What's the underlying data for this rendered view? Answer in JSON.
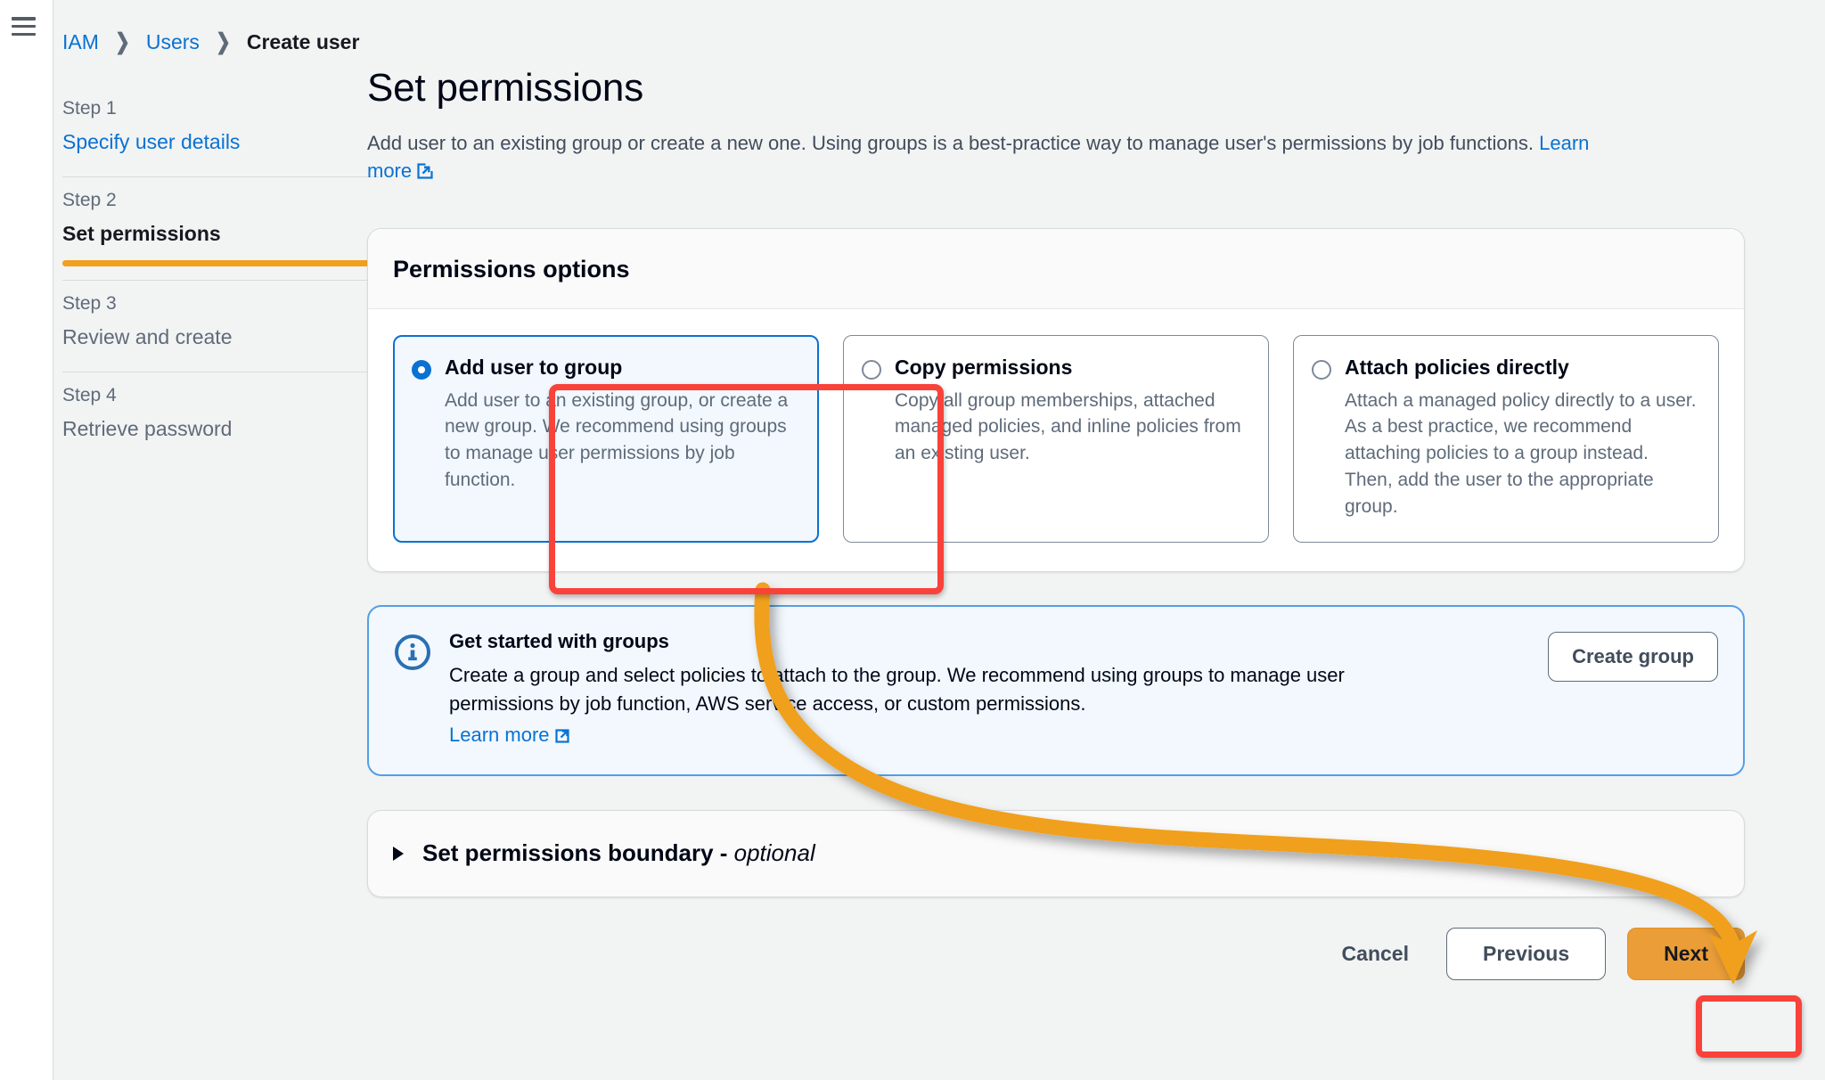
{
  "topbar": {
    "menu_icon": "hamburger-icon"
  },
  "breadcrumb": {
    "items": [
      {
        "label": "IAM",
        "type": "link"
      },
      {
        "label": "Users",
        "type": "link"
      },
      {
        "label": "Create user",
        "type": "current"
      }
    ],
    "separator": "❯"
  },
  "wizard": {
    "steps": [
      {
        "num": "Step 1",
        "label": "Specify user details",
        "state": "link"
      },
      {
        "num": "Step 2",
        "label": "Set permissions",
        "state": "active"
      },
      {
        "num": "Step 3",
        "label": "Review and create",
        "state": "default"
      },
      {
        "num": "Step 4",
        "label": "Retrieve password",
        "state": "default"
      }
    ],
    "active_bar_color": "#f0a01e"
  },
  "main": {
    "title": "Set permissions",
    "description": "Add user to an existing group or create a new one. Using groups is a best-practice way to manage user's permissions by job functions.",
    "learn_more": "Learn more",
    "external_link_icon": "external-link-icon"
  },
  "permissions_card": {
    "heading": "Permissions options",
    "options": [
      {
        "title": "Add user to group",
        "description": "Add user to an existing group, or create a new group. We recommend using groups to manage user permissions by job function.",
        "selected": true
      },
      {
        "title": "Copy permissions",
        "description": "Copy all group memberships, attached managed policies, and inline policies from an existing user.",
        "selected": false
      },
      {
        "title": "Attach policies directly",
        "description": "Attach a managed policy directly to a user. As a best practice, we recommend attaching policies to a group instead. Then, add the user to the appropriate group.",
        "selected": false
      }
    ]
  },
  "info_alert": {
    "icon": "info-circle-icon",
    "title": "Get started with groups",
    "text": "Create a group and select policies to attach to the group. We recommend using groups to manage user permissions by job function, AWS service access, or custom permissions.",
    "learn_more": "Learn more",
    "button_label": "Create group"
  },
  "boundary": {
    "caret_icon": "caret-right-icon",
    "title": "Set permissions boundary - ",
    "optional_suffix": "optional"
  },
  "footer": {
    "cancel_label": "Cancel",
    "previous_label": "Previous",
    "next_label": "Next"
  },
  "annotations": {
    "highlight_color": "#f9423a",
    "arrow_color": "#f0a01e",
    "highlighted_elements": [
      "add-user-to-group-option",
      "next-button"
    ]
  },
  "colors": {
    "link": "#0972d3",
    "page_bg": "#f2f3f3",
    "card_bg": "#ffffff",
    "selected_tile_bg": "#f2f8fd",
    "info_bg": "#f2f8fd",
    "next_button_bg": "#eb9e38"
  }
}
